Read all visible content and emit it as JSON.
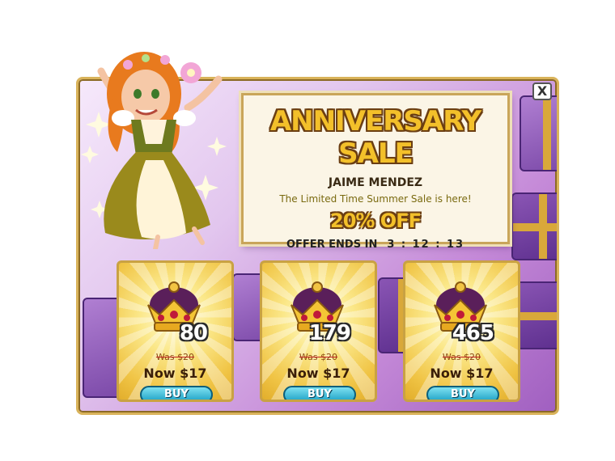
{
  "colors": {
    "frame_border": "#d9b35a",
    "title_fill": "#f3c02a",
    "title_outline": "#6b3e12",
    "buy_button": "#1a9fc4",
    "card_gold": "#f0c445",
    "background_purple": "#a05fc0"
  },
  "close_label": "X",
  "banner": {
    "title": "ANNIVERSARY SALE",
    "name": "JAIME MENDEZ",
    "subtitle": "The Limited Time Summer Sale is here!",
    "discount": "20% OFF",
    "offer_label": "OFFER ENDS IN",
    "timer": "3 : 12 : 13"
  },
  "offers": [
    {
      "quantity": "80",
      "was": "Was $20",
      "now": "Now $17",
      "buy": "BUY",
      "icon": "crown-icon"
    },
    {
      "quantity": "179",
      "was": "Was $20",
      "now": "Now $17",
      "buy": "BUY",
      "icon": "crown-icon"
    },
    {
      "quantity": "465",
      "was": "Was $20",
      "now": "Now $17",
      "buy": "BUY",
      "icon": "crown-icon"
    }
  ]
}
